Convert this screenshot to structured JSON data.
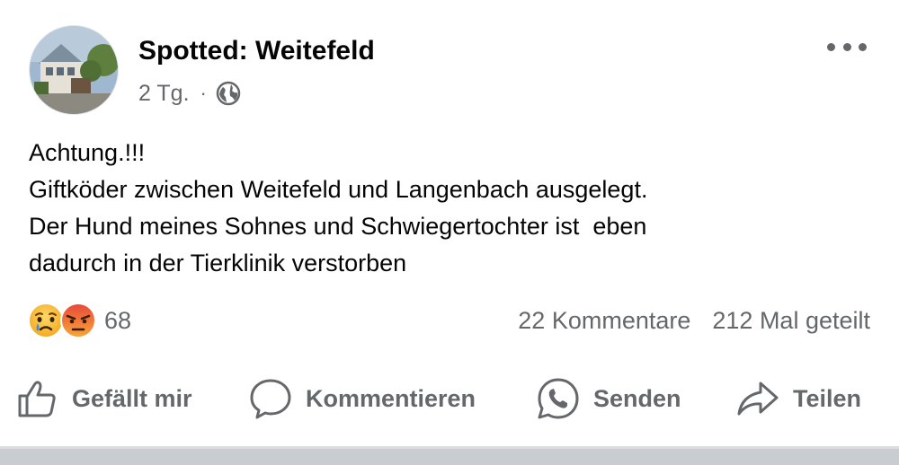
{
  "header": {
    "page_name": "Spotted: Weitefeld",
    "time_ago": "2 Tg.",
    "separator": "·",
    "privacy_icon": "globe-icon",
    "more_icon": "more-horizontal-icon"
  },
  "post": {
    "lines": [
      "Achtung.!!!",
      "Giftköder zwischen Weitefeld und Langenbach ausgelegt.",
      "Der Hund meines Sohnes und Schwiegertochter ist  eben",
      "dadurch in der Tierklinik verstorben"
    ]
  },
  "engagement": {
    "reaction_icons": [
      "sad-reaction-icon",
      "angry-reaction-icon"
    ],
    "reaction_count": "68",
    "comments": "22 Kommentare",
    "shares": "212 Mal geteilt"
  },
  "actions": {
    "like": "Gefällt mir",
    "comment": "Kommentieren",
    "send": "Senden",
    "share": "Teilen"
  },
  "colors": {
    "text": "#050505",
    "secondary_text": "#65676b",
    "sad_yellow": "#f7b125",
    "angry_red": "#e9710f",
    "divider": "#c9ccd1"
  }
}
